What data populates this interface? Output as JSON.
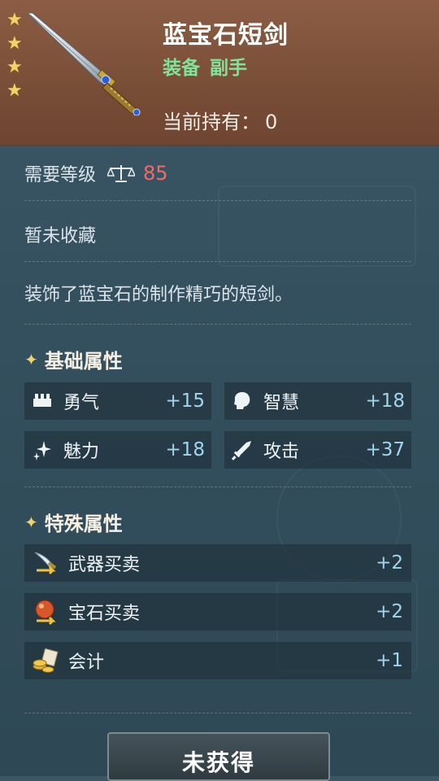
{
  "item": {
    "name": "蓝宝石短剑",
    "category_primary": "装备",
    "category_secondary": "副手",
    "owned_label": "当前持有：",
    "owned_value": "0",
    "star_count": 4
  },
  "requirement": {
    "label": "需要等级",
    "level": "85",
    "icon": "scale-icon"
  },
  "collection_status": "暂未收藏",
  "description": "装饰了蓝宝石的制作精巧的短剑。",
  "basic_attributes": {
    "title": "基础属性",
    "items": [
      {
        "label": "勇气",
        "value": "+15",
        "icon": "courage-icon"
      },
      {
        "label": "智慧",
        "value": "+18",
        "icon": "wisdom-head-icon"
      },
      {
        "label": "魅力",
        "value": "+18",
        "icon": "charm-sparkle-icon"
      },
      {
        "label": "攻击",
        "value": "+37",
        "icon": "sword-attack-icon"
      }
    ]
  },
  "special_attributes": {
    "title": "特殊属性",
    "items": [
      {
        "label": "武器买卖",
        "value": "+2",
        "icon": "weapon-trade-icon"
      },
      {
        "label": "宝石买卖",
        "value": "+2",
        "icon": "gem-trade-icon"
      },
      {
        "label": "会计",
        "value": "+1",
        "icon": "accounting-coins-icon"
      }
    ]
  },
  "action_button": "未获得",
  "colors": {
    "header_bg": "#7a4f38",
    "panel_bg": "#34505e",
    "level_red": "#f06a6a",
    "category_green": "#7fe39a",
    "value_blue": "#9fd5ee",
    "star_gold": "#f2d36a"
  }
}
